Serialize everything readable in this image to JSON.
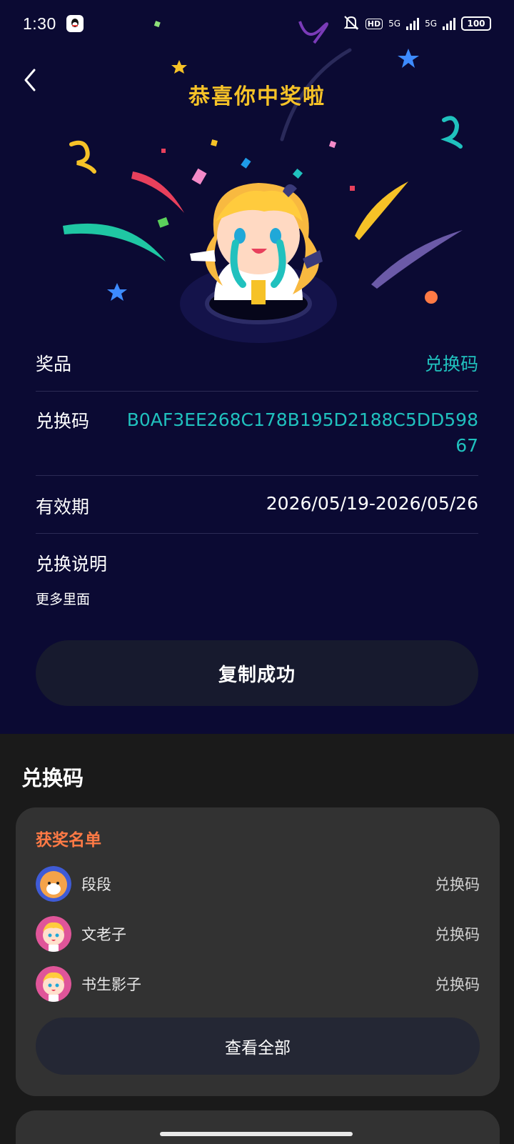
{
  "status_bar": {
    "time": "1:30",
    "hd": "HD",
    "net1": "5G",
    "net2": "5G",
    "battery": "100"
  },
  "header": {
    "title": "恭喜你中奖啦"
  },
  "details": {
    "prize_label": "奖品",
    "prize_value": "兑换码",
    "code_label": "兑换码",
    "code_value": "B0AF3EE268C178B195D2188C5DD59867",
    "validity_label": "有效期",
    "validity_value": "2026/05/19-2026/05/26",
    "instructions_label": "兑换说明",
    "instructions_text": "更多里面"
  },
  "copy_button": {
    "label": "复制成功"
  },
  "section": {
    "title": "兑换码"
  },
  "winners": {
    "title": "获奖名单",
    "items": [
      {
        "name": "段段",
        "prize": "兑换码"
      },
      {
        "name": "文老子",
        "prize": "兑换码"
      },
      {
        "name": "书生影子",
        "prize": "兑换码"
      }
    ],
    "view_all_label": "查看全部"
  },
  "colors": {
    "accent_teal": "#20c1be",
    "title_yellow": "#f6c227",
    "winner_title": "#ff7a45",
    "top_background": "#0b0a33"
  }
}
